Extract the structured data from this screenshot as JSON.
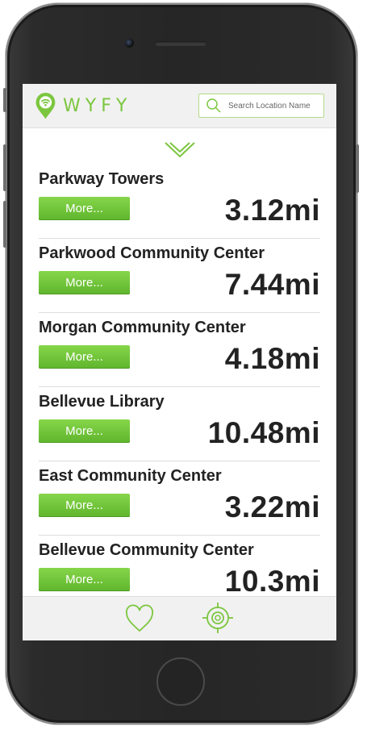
{
  "app": {
    "brand": "WYFY",
    "accent_color": "#7cc63f"
  },
  "search": {
    "placeholder": "Search Location Name",
    "icon": "search-icon"
  },
  "header": {
    "collapse_icon": "chevron-down-icon"
  },
  "locations": [
    {
      "name": "Parkway Towers",
      "more_label": "More...",
      "distance": "3.12mi"
    },
    {
      "name": "Parkwood Community Center",
      "more_label": "More...",
      "distance": "7.44mi"
    },
    {
      "name": "Morgan Community Center",
      "more_label": "More...",
      "distance": "4.18mi"
    },
    {
      "name": "Bellevue Library",
      "more_label": "More...",
      "distance": "10.48mi"
    },
    {
      "name": "East Community Center",
      "more_label": "More...",
      "distance": "3.22mi"
    },
    {
      "name": "Bellevue Community Center",
      "more_label": "More...",
      "distance": "10.3mi"
    }
  ],
  "bottom_nav": {
    "favorites_icon": "heart-icon",
    "locate_icon": "crosshair-icon"
  }
}
